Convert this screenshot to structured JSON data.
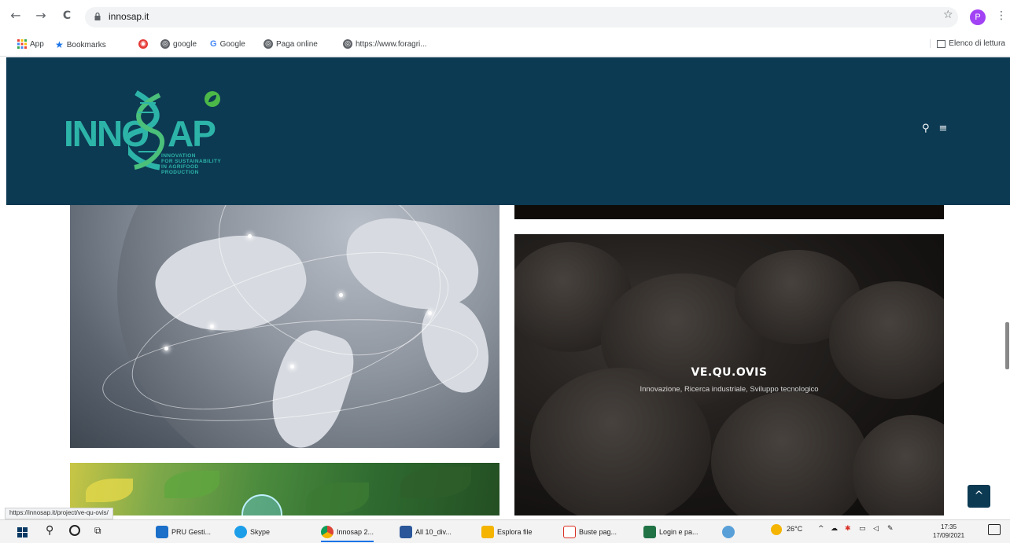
{
  "browser": {
    "back": "←",
    "forward": "→",
    "reload": "C",
    "url": "innosap.it",
    "star": "☆",
    "profile_initial": "P",
    "menu": "⋮"
  },
  "bookmarks": [
    {
      "label": "App",
      "icon": "apps-grid-icon"
    },
    {
      "label": "Bookmarks",
      "icon": "star-icon"
    },
    {
      "label": "",
      "icon": "red-circle-icon"
    },
    {
      "label": "google",
      "icon": "globe-icon"
    },
    {
      "label": "Google",
      "icon": "google-g-icon"
    },
    {
      "label": "Paga online",
      "icon": "globe-icon"
    },
    {
      "label": "https://www.foragri...",
      "icon": "globe-icon"
    }
  ],
  "reading_list": "Elenco di lettura",
  "site": {
    "logo_main_left": "INNO",
    "logo_main_right": "AP",
    "logo_sub": "INNOVATION\nFOR SUSTAINABILITY\nIN AGRIFOOD\nPRODUCTION",
    "search_icon": "⚲",
    "menu_icon": "≡"
  },
  "cards": {
    "sheep_title": "VE.QU.OVIS",
    "sheep_subtitle": "Innovazione, Ricerca industriale, Sviluppo tecnologico"
  },
  "back_to_top": "^",
  "status_url": "https://innosap.it/project/ve-qu-ovis/",
  "taskbar": {
    "items": [
      {
        "label": "PRU Gesti...",
        "color": "#1b6fc9"
      },
      {
        "label": "Skype",
        "color": "#1d9ee8"
      },
      {
        "label": "Innosap 2...",
        "color": "#db4437"
      },
      {
        "label": "All 10_div...",
        "color": "#2b579a"
      },
      {
        "label": "Esplora file",
        "color": "#f4b400"
      },
      {
        "label": "Buste pag...",
        "color": "#d93025"
      },
      {
        "label": "Login e pa...",
        "color": "#217346"
      }
    ],
    "temperature": "26°C",
    "time": "17:35",
    "date": "17/09/2021"
  }
}
